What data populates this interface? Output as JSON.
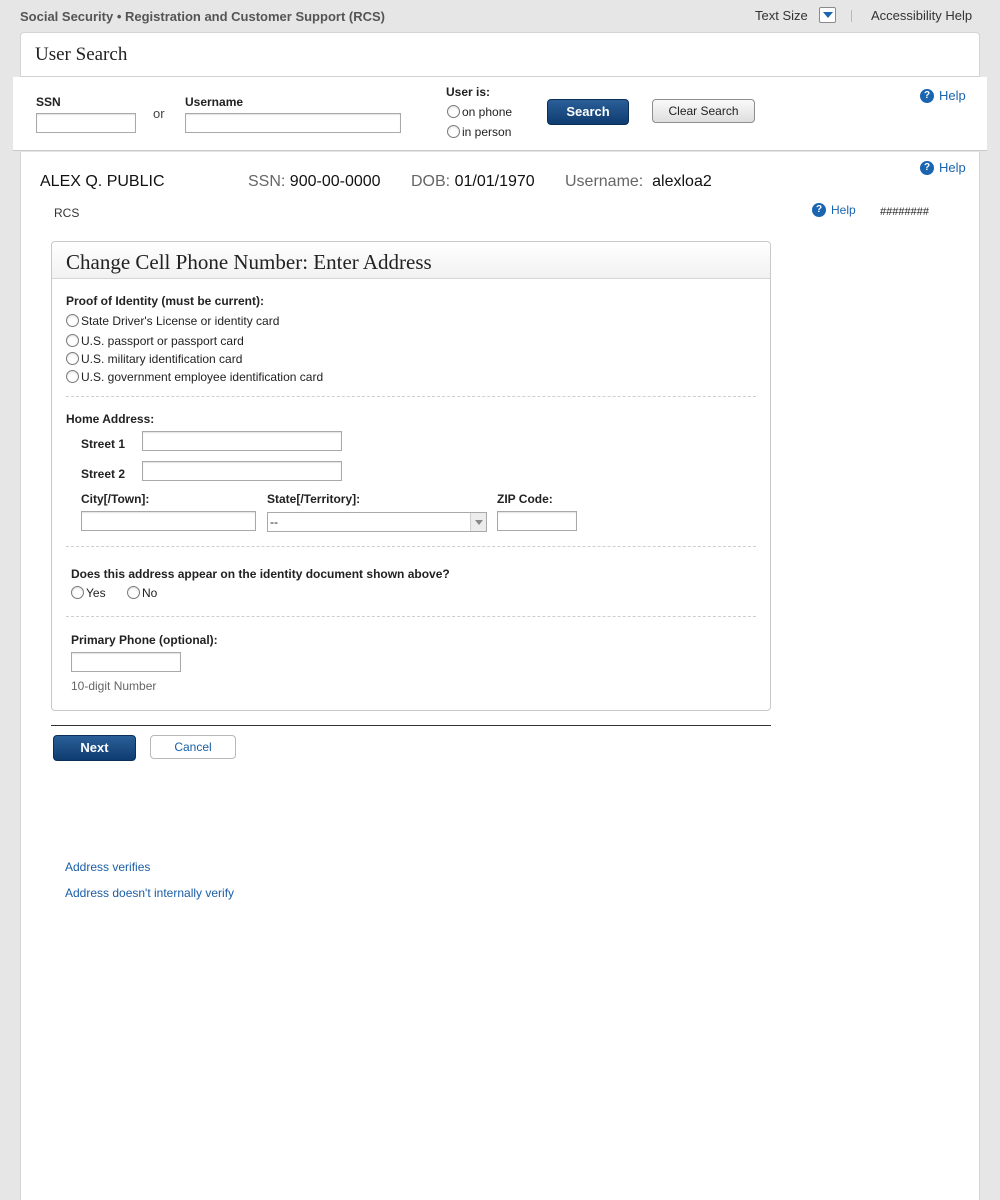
{
  "topbar": {
    "app_title": "Social Security • Registration and Customer Support (RCS)",
    "text_size_label": "Text Size",
    "accessibility_help": "Accessibility Help"
  },
  "page": {
    "title": "User Search"
  },
  "search": {
    "ssn_label": "SSN",
    "ssn_value": "",
    "or_label": "or",
    "username_label": "Username",
    "username_value": "",
    "user_is_label": "User is:",
    "user_is_options": [
      "on phone",
      "in person"
    ],
    "search_button": "Search",
    "clear_button": "Clear Search",
    "help": "Help"
  },
  "person": {
    "name": "ALEX Q. PUBLIC",
    "ssn_label": "SSN:",
    "ssn": "900-00-0000",
    "dob_label": "DOB:",
    "dob": "01/01/1970",
    "username_label": "Username:",
    "username": "alexloa2",
    "help": "Help"
  },
  "context": {
    "app_code": "RCS",
    "help": "Help",
    "ref": "########"
  },
  "form": {
    "title": "Change Cell Phone Number: Enter Address",
    "proof_label": "Proof of Identity (must be current):",
    "proof_options": [
      "State Driver's License or identity card",
      "U.S. passport or passport card",
      "U.S. military identification card",
      "U.S. government employee identification card"
    ],
    "home_address_label": "Home Address:",
    "street1_label": "Street 1",
    "street2_label": "Street 2",
    "city_label": "City[/Town]:",
    "state_label": "State[/Territory]:",
    "state_value": "--",
    "zip_label": "ZIP Code:",
    "address_question": "Does this address appear on the identity document shown above?",
    "yes_label": "Yes",
    "no_label": "No",
    "phone_label": "Primary Phone (optional):",
    "phone_hint": "10-digit Number"
  },
  "actions": {
    "next": "Next",
    "cancel": "Cancel"
  },
  "links": {
    "address_verifies": "Address verifies",
    "address_not_verify": "Address doesn't internally verify"
  },
  "colors": {
    "primary_button": "#0f3c70",
    "link": "#1a5ea6",
    "help_icon": "#1a65b0"
  }
}
